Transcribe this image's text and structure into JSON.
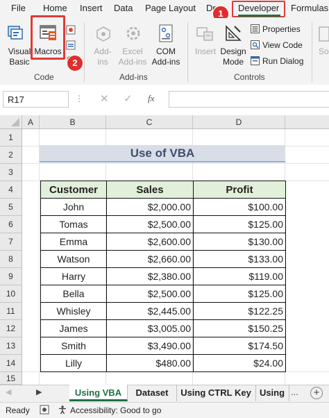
{
  "menu": {
    "tabs": [
      "File",
      "Home",
      "Insert",
      "Data",
      "Page Layout",
      "Dr",
      "Developer",
      "Formulas"
    ],
    "active_tab": "Developer"
  },
  "badges": {
    "step1": "1",
    "step2": "2"
  },
  "ribbon": {
    "code_group": {
      "label": "Code",
      "visual_basic": "Visual\nBasic",
      "macros": "Macros"
    },
    "addins_group": {
      "label": "Add-ins",
      "add_ins": "Add-\nins",
      "excel_add_ins": "Excel\nAdd-ins",
      "com_add_ins": "COM\nAdd-ins"
    },
    "controls_group": {
      "label": "Controls",
      "insert": "Insert",
      "design_mode": "Design\nMode",
      "properties": "Properties",
      "view_code": "View Code",
      "run_dialog": "Run Dialog"
    },
    "cut_off_label": "So"
  },
  "formula_bar": {
    "name_box": "R17",
    "fx": "fx",
    "value": ""
  },
  "grid": {
    "columns": [
      "A",
      "B",
      "C",
      "D"
    ],
    "rows": [
      "1",
      "2",
      "3",
      "4",
      "5",
      "6",
      "7",
      "8",
      "9",
      "10",
      "11",
      "12",
      "13",
      "14",
      "15"
    ],
    "title": "Use of VBA",
    "headers": [
      "Customer",
      "Sales",
      "Profit"
    ],
    "data": [
      [
        "John",
        "$2,000.00",
        "$100.00"
      ],
      [
        "Tomas",
        "$2,500.00",
        "$125.00"
      ],
      [
        "Emma",
        "$2,600.00",
        "$130.00"
      ],
      [
        "Watson",
        "$2,660.00",
        "$133.00"
      ],
      [
        "Harry",
        "$2,380.00",
        "$119.00"
      ],
      [
        "Bella",
        "$2,500.00",
        "$125.00"
      ],
      [
        "Whisley",
        "$2,445.00",
        "$122.25"
      ],
      [
        "James",
        "$3,005.00",
        "$150.25"
      ],
      [
        "Smith",
        "$3,490.00",
        "$174.50"
      ],
      [
        "Lilly",
        "$480.00",
        "$24.00"
      ]
    ]
  },
  "sheet_tabs": {
    "tabs": [
      "Using VBA",
      "Dataset",
      "Using CTRL Key",
      "Using"
    ],
    "active": "Using VBA",
    "more": "..."
  },
  "status": {
    "ready": "Ready",
    "accessibility": "Accessibility: Good to go"
  },
  "colors": {
    "accent_green": "#217346",
    "highlight_red": "#e03a3a",
    "title_fill": "#d9dde6",
    "header_fill": "#e2efda"
  }
}
